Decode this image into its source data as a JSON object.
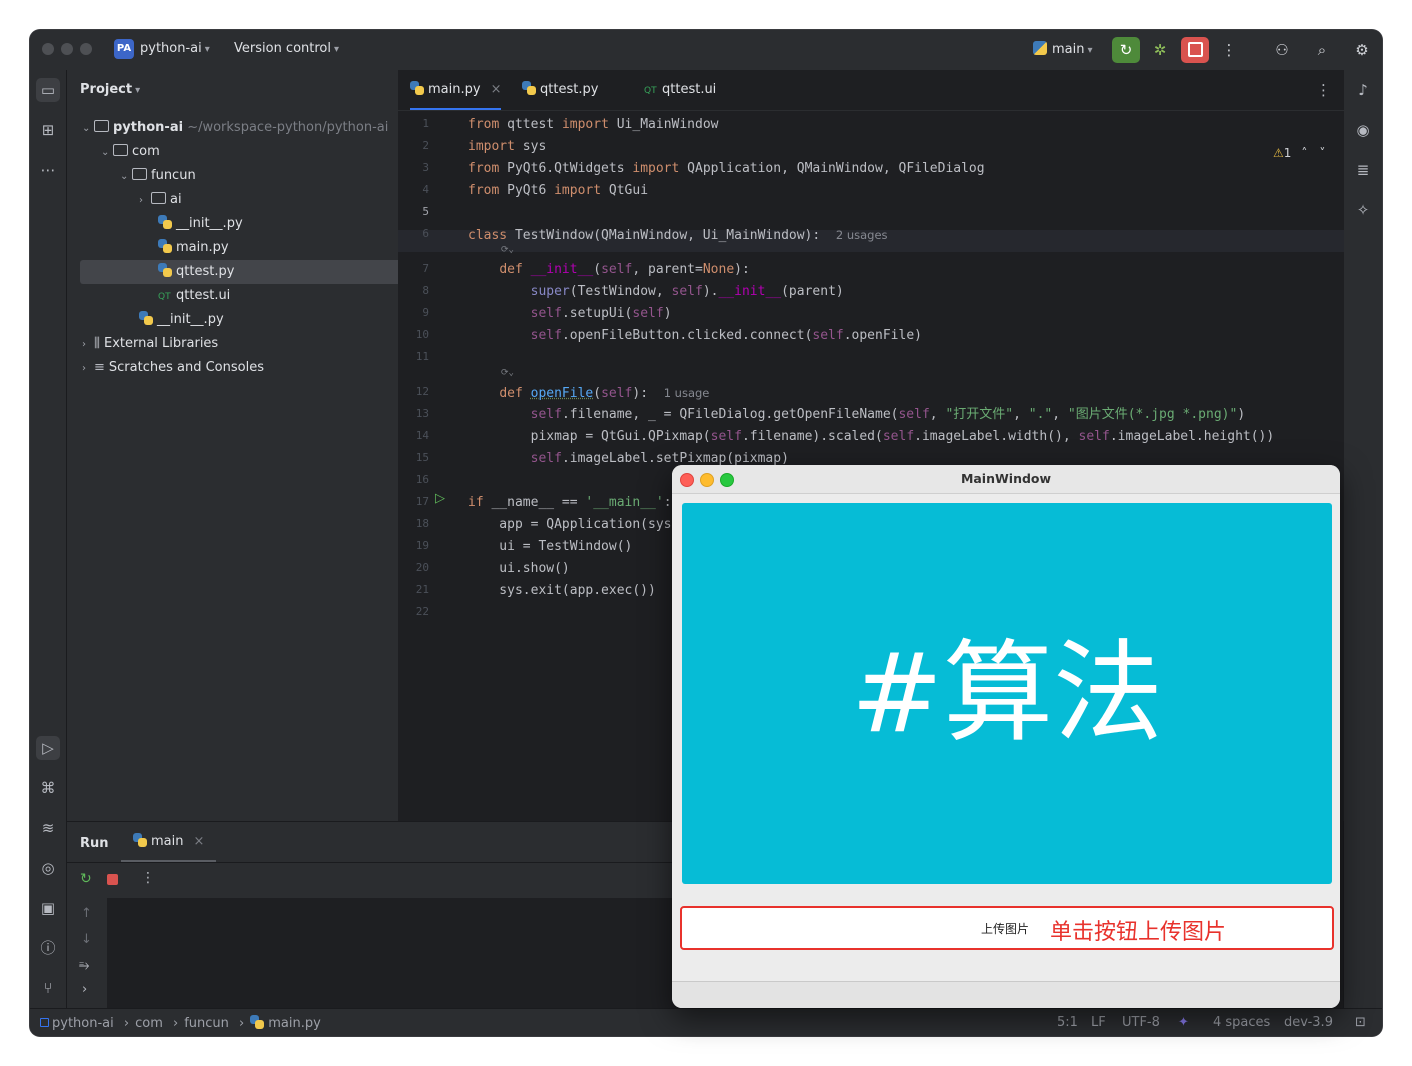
{
  "ide": {
    "project_badge": "PA",
    "project_name": "python-ai",
    "vcs_label": "Version control",
    "branch": "main"
  },
  "project_panel": {
    "title": "Project",
    "tree": [
      {
        "label": "python-ai",
        "path": "~/workspace-python/python-ai",
        "kind": "folder",
        "depth": 0,
        "expanded": true
      },
      {
        "label": "com",
        "kind": "package",
        "depth": 1,
        "expanded": true
      },
      {
        "label": "funcun",
        "kind": "package",
        "depth": 2,
        "expanded": true
      },
      {
        "label": "ai",
        "kind": "package",
        "depth": 3,
        "expanded": false
      },
      {
        "label": "__init__.py",
        "kind": "py",
        "depth": 4
      },
      {
        "label": "main.py",
        "kind": "py",
        "depth": 4
      },
      {
        "label": "qttest.py",
        "kind": "py",
        "depth": 4,
        "selected": true
      },
      {
        "label": "qttest.ui",
        "kind": "ui",
        "depth": 4
      },
      {
        "label": "__init__.py",
        "kind": "py",
        "depth": 3
      },
      {
        "label": "External Libraries",
        "kind": "lib",
        "depth": 0,
        "expanded": false
      },
      {
        "label": "Scratches and Consoles",
        "kind": "scratch",
        "depth": 0,
        "expanded": false
      }
    ]
  },
  "editor": {
    "tabs": [
      {
        "label": "main.py",
        "active": true,
        "closable": true
      },
      {
        "label": "qttest.py",
        "active": false
      },
      {
        "label": "qttest.ui",
        "active": false
      }
    ],
    "warning_count": "1",
    "line_numbers": [
      "1",
      "2",
      "3",
      "4",
      "5",
      "6",
      "7",
      "8",
      "9",
      "10",
      "11",
      "12",
      "13",
      "14",
      "15",
      "16",
      "17",
      "18",
      "19",
      "20",
      "21",
      "22"
    ],
    "hints": {
      "class_usages": "2 usages",
      "openfile_usages": "1 usage"
    }
  },
  "run_panel": {
    "title": "Run",
    "tab_label": "main"
  },
  "status_bar": {
    "breadcrumbs": [
      "python-ai",
      "com",
      "funcun",
      "main.py"
    ],
    "position": "5:1",
    "line_sep": "LF",
    "encoding": "UTF-8",
    "indent": "4 spaces",
    "interpreter": "dev-3.9"
  },
  "qt_window": {
    "title": "MainWindow",
    "image_text": "#算法",
    "button_label": "上传图片",
    "annotation": "单击按钮上传图片"
  },
  "colors": {
    "accent": "#3574f0",
    "run_button": "#4e8a3a",
    "stop_button": "#d9534f",
    "image_bg": "#06bcd6",
    "annotation": "#e8322c"
  },
  "icons": [
    "project-icon",
    "structure-icon",
    "more-icon",
    "run-icon",
    "python-console-icon",
    "layers-icon",
    "services-icon",
    "terminal-icon",
    "problems-icon",
    "git-icon",
    "bell-icon",
    "ai-assistant-icon",
    "database-icon",
    "plugin-icon",
    "search-icon",
    "gear-icon",
    "add-user-icon",
    "debug-icon",
    "stop-icon",
    "rerun-icon"
  ]
}
